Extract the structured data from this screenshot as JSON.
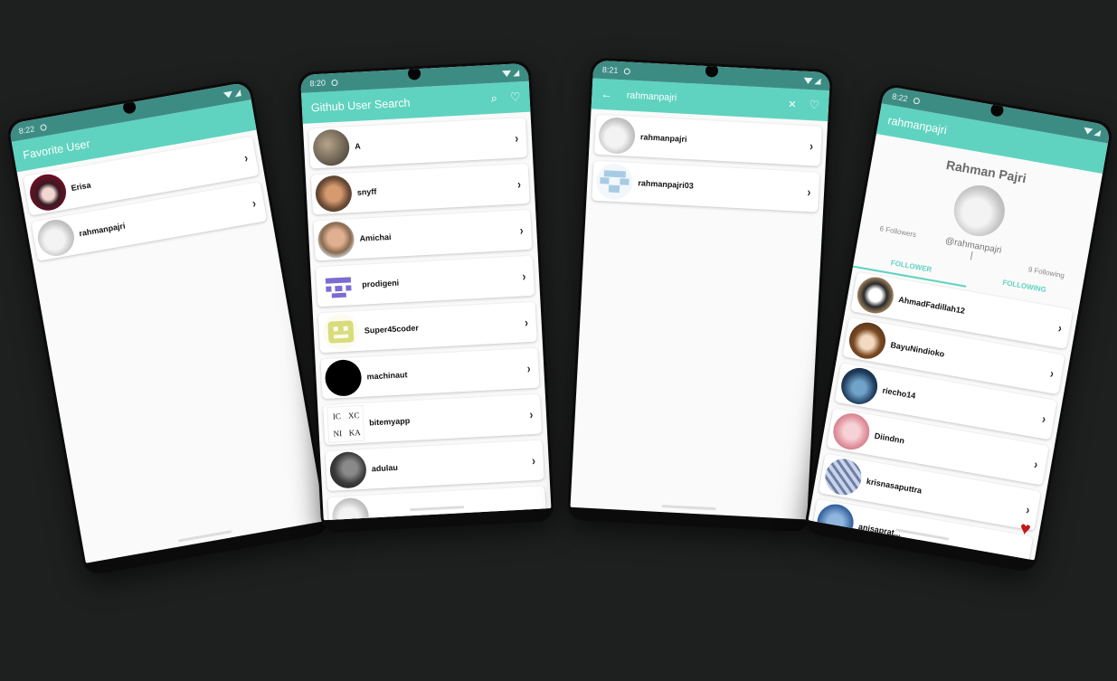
{
  "screen1": {
    "time": "8:22",
    "title": "Favorite User",
    "users": [
      {
        "name": "Erisa",
        "avatar": "anime"
      },
      {
        "name": "rahmanpajri",
        "avatar": "cat"
      }
    ]
  },
  "screen2": {
    "time": "8:20",
    "title": "Github User Search",
    "users": [
      {
        "name": "A"
      },
      {
        "name": "snyff"
      },
      {
        "name": "Amichai"
      },
      {
        "name": "prodigeni"
      },
      {
        "name": "Super45coder"
      },
      {
        "name": "machinaut"
      },
      {
        "name": "bitemyapp"
      },
      {
        "name": "adulau"
      }
    ],
    "logo_text": [
      "IC",
      "XC",
      "NI",
      "KA"
    ]
  },
  "screen3": {
    "time": "8:21",
    "query": "rahmanpajri",
    "users": [
      {
        "name": "rahmanpajri"
      },
      {
        "name": "rahmanpajri03"
      }
    ]
  },
  "screen4": {
    "time": "8:22",
    "title": "rahmanpajri",
    "full_name": "Rahman Pajri",
    "username": "@rahmanpajri",
    "followers": "6 Followers",
    "following": "9 Following",
    "separator": "|",
    "tabs": [
      "FOLLOWER",
      "FOLLOWING"
    ],
    "users": [
      {
        "name": "AhmadFadillah12"
      },
      {
        "name": "BayuNindioko"
      },
      {
        "name": "riecho14"
      },
      {
        "name": "Diindnn"
      },
      {
        "name": "krisnasaputtra"
      },
      {
        "name": "anisaprat..."
      }
    ]
  },
  "icons": {
    "chevron": "›",
    "search": "⌕",
    "heart_outline": "♡",
    "heart_filled": "♥",
    "back": "←",
    "close": "✕"
  },
  "colors": {
    "status_bar": "#3d8c84",
    "app_bar": "#5fd3bf",
    "accent": "#5fd3bf",
    "heart": "#c01a1a",
    "background": "#1e1f1f"
  }
}
